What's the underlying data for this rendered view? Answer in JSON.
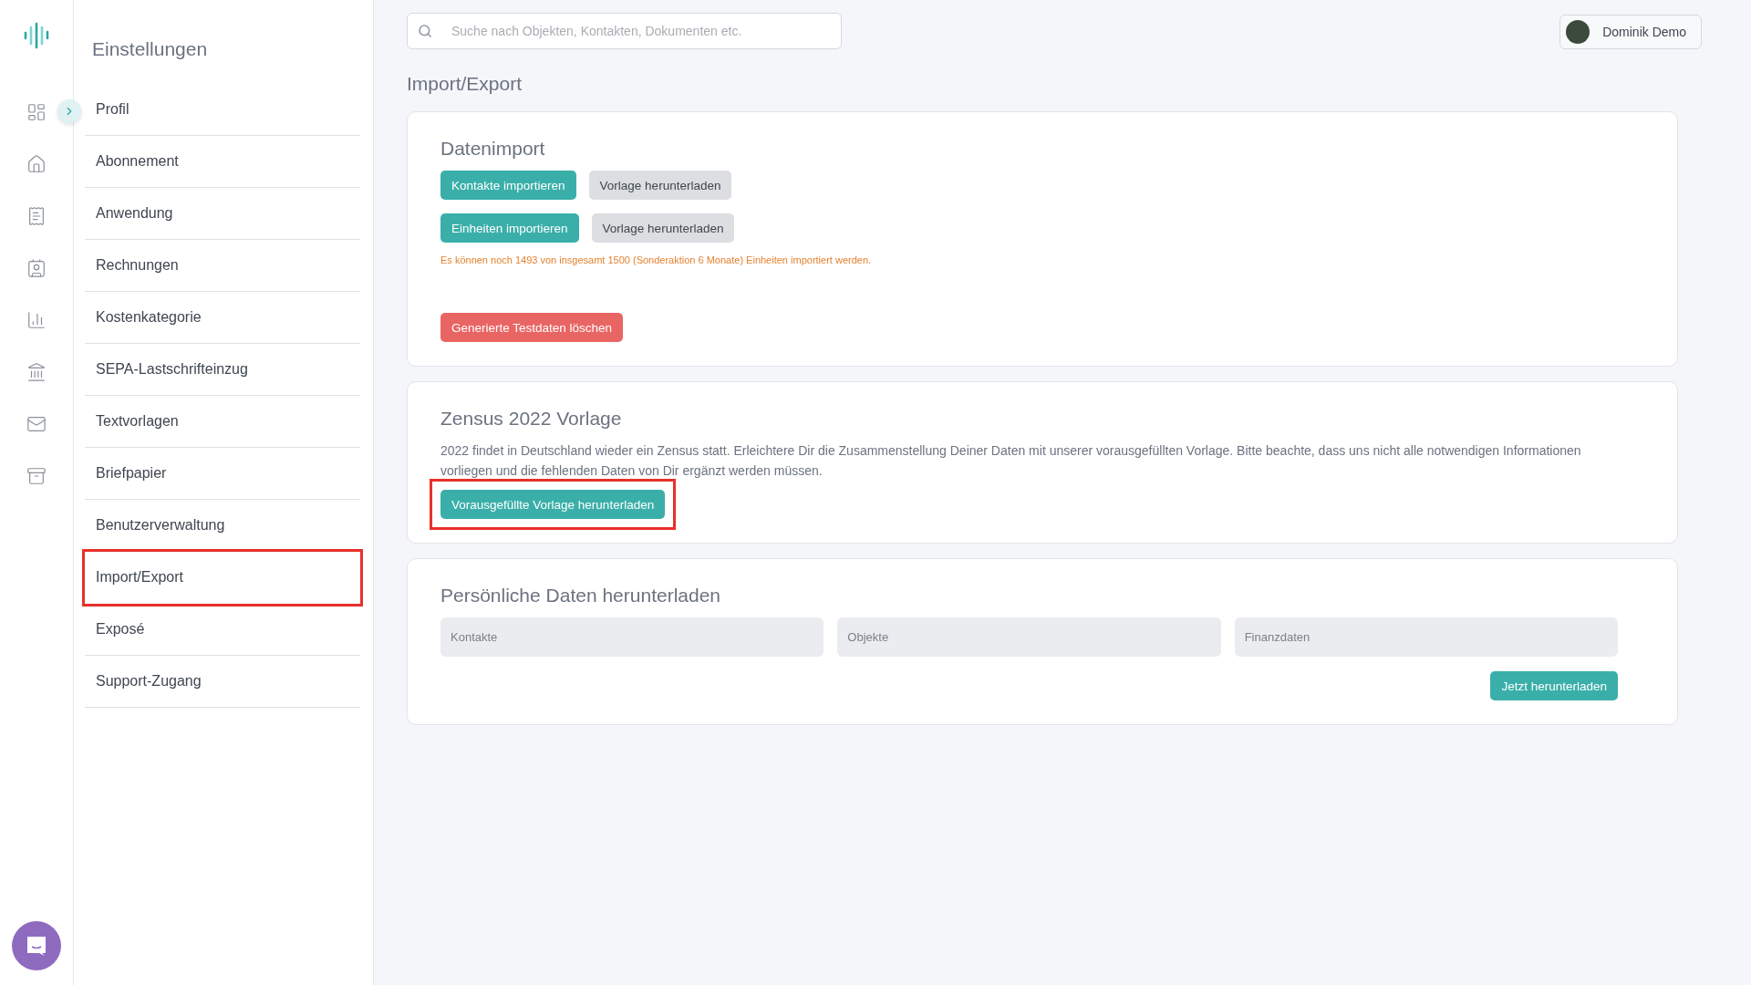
{
  "settings_menu": {
    "title": "Einstellungen",
    "items": [
      {
        "label": "Profil",
        "highlighted": false
      },
      {
        "label": "Abonnement",
        "highlighted": false
      },
      {
        "label": "Anwendung",
        "highlighted": false
      },
      {
        "label": "Rechnungen",
        "highlighted": false
      },
      {
        "label": "Kostenkategorie",
        "highlighted": false
      },
      {
        "label": "SEPA-Lastschrifteinzug",
        "highlighted": false
      },
      {
        "label": "Textvorlagen",
        "highlighted": false
      },
      {
        "label": "Briefpapier",
        "highlighted": false
      },
      {
        "label": "Benutzerverwaltung",
        "highlighted": false
      },
      {
        "label": "Import/Export",
        "highlighted": true
      },
      {
        "label": "Exposé",
        "highlighted": false
      },
      {
        "label": "Support-Zugang",
        "highlighted": false
      }
    ]
  },
  "search": {
    "placeholder": "Suche nach Objekten, Kontakten, Dokumenten etc."
  },
  "user": {
    "name": "Dominik Demo"
  },
  "page_title": "Import/Export",
  "datenimport": {
    "title": "Datenimport",
    "rows": [
      {
        "import_button": "Kontakte importieren",
        "template_button": "Vorlage herunterladen"
      },
      {
        "import_button": "Einheiten importieren",
        "template_button": "Vorlage herunterladen"
      }
    ],
    "notice": "Es können noch 1493 von insgesamt 1500 (Sonderaktion 6 Monate) Einheiten importiert werden.",
    "delete_button": "Generierte Testdaten löschen"
  },
  "zensus": {
    "title": "Zensus 2022 Vorlage",
    "text": "2022 findet in Deutschland wieder ein Zensus statt. Erleichtere Dir die Zusammenstellung Deiner Daten mit unserer vorausgefüllten Vorlage. Bitte beachte, dass uns nicht alle notwendigen Informationen vorliegen und die fehlenden Daten von Dir ergänzt werden müssen.",
    "button": "Vorausgefüllte Vorlage herunterladen",
    "highlighted": true
  },
  "personal_data": {
    "title": "Persönliche Daten herunterladen",
    "fields": [
      {
        "placeholder": "Kontakte"
      },
      {
        "placeholder": "Objekte"
      },
      {
        "placeholder": "Finanzdaten"
      }
    ],
    "button": "Jetzt herunterladen"
  }
}
